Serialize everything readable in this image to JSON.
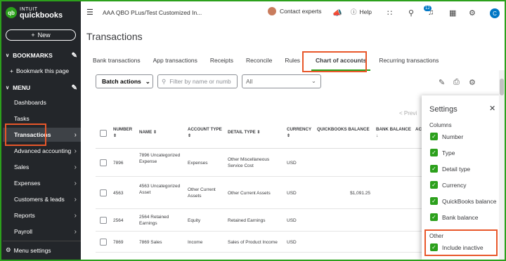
{
  "sidebar": {
    "brand_line1": "INTUIT",
    "brand_line2": "quickbooks",
    "new_label": "New",
    "bookmarks_label": "BOOKMARKS",
    "bookmark_page_label": "Bookmark this page",
    "menu_label": "MENU",
    "items": [
      {
        "label": "Dashboards"
      },
      {
        "label": "Tasks"
      },
      {
        "label": "Transactions"
      },
      {
        "label": "Advanced accounting"
      },
      {
        "label": "Sales"
      },
      {
        "label": "Expenses"
      },
      {
        "label": "Customers & leads"
      },
      {
        "label": "Reports"
      },
      {
        "label": "Payroll"
      }
    ],
    "menu_settings_label": "Menu settings"
  },
  "topbar": {
    "company": "AAA QBO PLus/Test Customized In...",
    "contact_label": "Contact experts",
    "help_label": "Help",
    "notification_count": "12",
    "user_initial": "C"
  },
  "page": {
    "title": "Transactions",
    "tabs": [
      {
        "label": "Bank transactions"
      },
      {
        "label": "App transactions"
      },
      {
        "label": "Receipts"
      },
      {
        "label": "Reconcile"
      },
      {
        "label": "Rules"
      },
      {
        "label": "Chart of accounts"
      },
      {
        "label": "Recurring transactions"
      }
    ],
    "batch_actions_label": "Batch actions",
    "filter_placeholder": "Filter by name or numb",
    "type_select_value": "All",
    "prev_label": "< Previ"
  },
  "table": {
    "headers": {
      "number": "NUMBER",
      "name": "NAME",
      "account_type": "ACCOUNT TYPE",
      "detail_type": "DETAIL TYPE",
      "currency": "CURRENCY",
      "qb_balance": "QUICKBOOKS BALANCE",
      "bank_balance": "BANK BALANCE",
      "extra": "AC"
    },
    "rows": [
      {
        "number": "7896",
        "name": "7896 Uncategorized Expense",
        "account_type": "Expenses",
        "detail_type": "Other Miscellaneous Service Cost",
        "currency": "USD",
        "qb_balance": ""
      },
      {
        "number": "4563",
        "name": "4563 Uncategorized Asset",
        "account_type": "Other Current Assets",
        "detail_type": "Other Current Assets",
        "currency": "USD",
        "qb_balance": "$1,091.25"
      },
      {
        "number": "2564",
        "name": "2564 Retained Earnings",
        "account_type": "Equity",
        "detail_type": "Retained Earnings",
        "currency": "USD",
        "qb_balance": ""
      },
      {
        "number": "7869",
        "name": "7869 Sales",
        "account_type": "Income",
        "detail_type": "Sales of Product Income",
        "currency": "USD",
        "qb_balance": ""
      }
    ]
  },
  "settings": {
    "title": "Settings",
    "columns_label": "Columns",
    "options": [
      {
        "label": "Number"
      },
      {
        "label": "Type"
      },
      {
        "label": "Detail type"
      },
      {
        "label": "Currency"
      },
      {
        "label": "QuickBooks balance"
      },
      {
        "label": "Bank balance"
      }
    ],
    "other_label": "Other",
    "include_inactive_label": "Include inactive"
  }
}
